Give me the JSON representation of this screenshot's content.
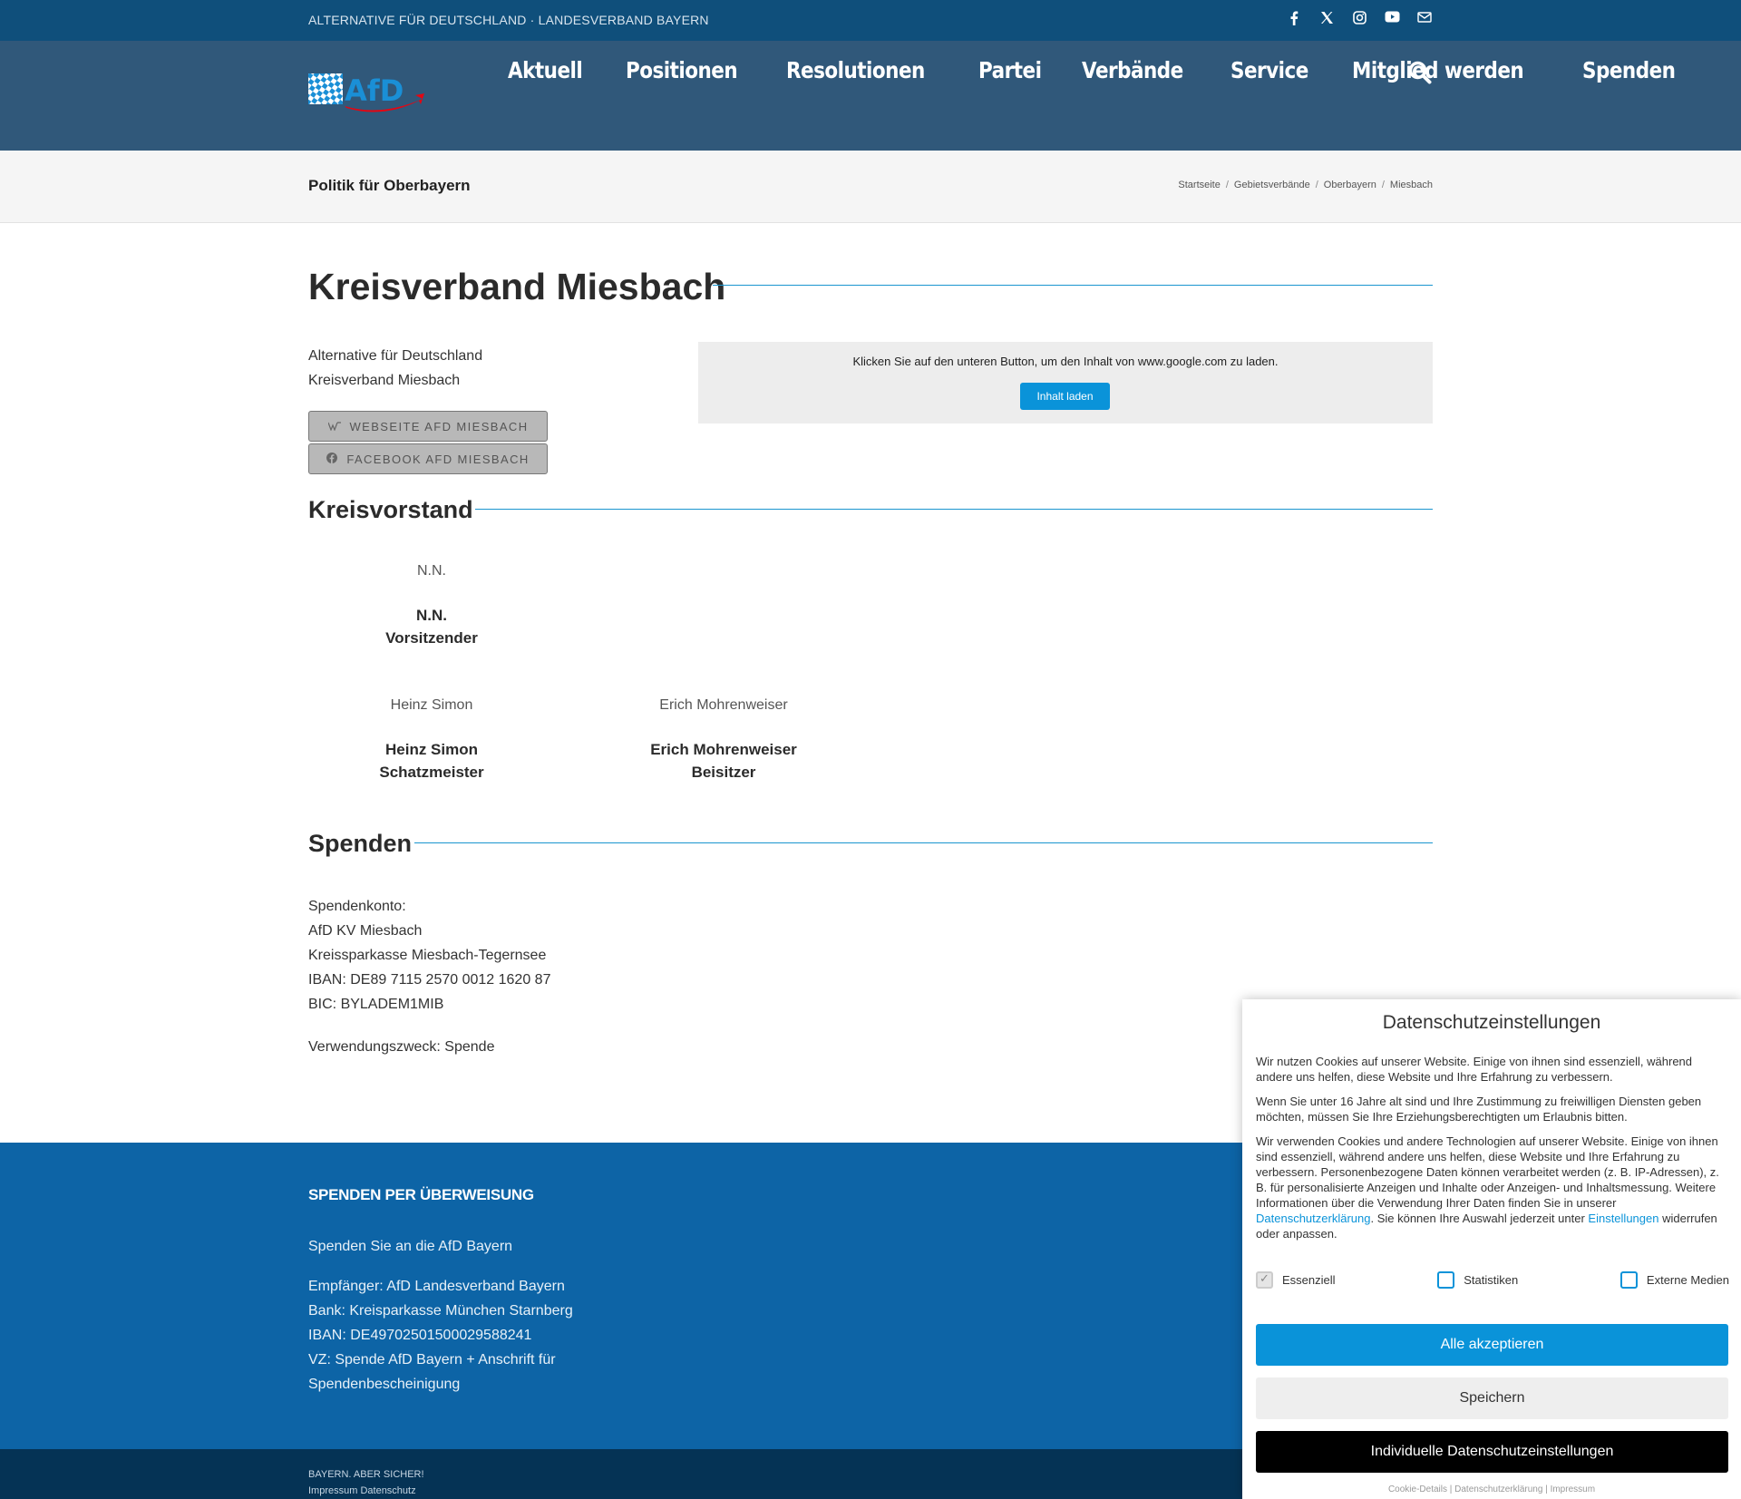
{
  "topbar": {
    "tagline": "ALTERNATIVE FÜR DEUTSCHLAND · LANDESVERBAND BAYERN",
    "social_icons": [
      "facebook-icon",
      "x-icon",
      "instagram-icon",
      "youtube-icon",
      "mail-icon"
    ]
  },
  "header": {
    "logo_text": "AfD",
    "nav": [
      "Aktuell",
      "Positionen",
      "Resolutionen",
      "Partei",
      "Verbände",
      "Service",
      "Mitglied werden",
      "Spenden"
    ]
  },
  "breadcrumb_bar": {
    "title": "Politik für Oberbayern",
    "crumbs": [
      "Startseite",
      "Gebietsverbände",
      "Oberbayern",
      "Miesbach"
    ],
    "separator": "/"
  },
  "main": {
    "heading": "Kreisverband Miesbach",
    "intro_line1": "Alternative für Deutschland",
    "intro_line2": "Kreisverband Miesbach",
    "website_button": "WEBSEITE AFD MIESBACH",
    "facebook_button": "FACEBOOK AFD MIESBACH",
    "map_consent_text": "Klicken Sie auf den unteren Button, um den Inhalt von www.google.com zu laden.",
    "map_consent_button": "Inhalt laden",
    "board_heading": "Kreisvorstand",
    "board": [
      {
        "image_alt": "N.N.",
        "name": "N.N.",
        "role": "Vorsitzender"
      },
      {
        "image_alt": "Heinz Simon",
        "name": "Heinz Simon",
        "role": "Schatzmeister"
      },
      {
        "image_alt": "Erich Mohrenweiser",
        "name": "Erich Mohrenweiser",
        "role": "Beisitzer"
      }
    ],
    "donation_heading": "Spenden",
    "donation_lines": [
      "Spendenkonto:",
      "AfD KV Miesbach",
      "Kreissparkasse Miesbach-Tegernsee",
      "IBAN: DE89 7115 2570 0012 1620 87",
      "BIC: BYLADEM1MIB"
    ],
    "donation_purpose": "Verwendungszweck: Spende"
  },
  "footer": {
    "title": "SPENDEN PER ÜBERWEISUNG",
    "intro": "Spenden Sie an die AfD Bayern",
    "lines": [
      "Empfänger: AfD Landesverband Bayern",
      "Bank: Kreisparkasse München Starnberg",
      "IBAN: DE4970250150002958824​1",
      "VZ: Spende AfD Bayern + Anschrift für",
      "Spendenbescheinigung"
    ],
    "sub_line1": "BAYERN. ABER SICHER!",
    "sub_line2": "Impressum Datenschutz"
  },
  "cookie_panel": {
    "title": "Datenschutzeinstellungen",
    "p1": "Wir nutzen Cookies auf unserer Website. Einige von ihnen sind essenziell, während andere uns helfen, diese Website und Ihre Erfahrung zu verbessern.",
    "p2": "Wenn Sie unter 16 Jahre alt sind und Ihre Zustimmung zu freiwilligen Diensten geben möchten, müssen Sie Ihre Erziehungsberechtigten um Erlaubnis bitten.",
    "p3_part1": "Wir verwenden Cookies und andere Technologien auf unserer Website. Einige von ihnen sind essenziell, während andere uns helfen, diese Website und Ihre Erfahrung zu verbessern. Personenbezogene Daten können verarbeitet werden (z. B. IP-Adressen), z. B. für personalisierte Anzeigen und Inhalte oder Anzeigen- und Inhaltsmessung. Weitere Informationen über die Verwendung Ihrer Daten finden Sie in unserer ",
    "p3_link1": "Datenschutzerklärung",
    "p3_part2": ". Sie können Ihre Auswahl jederzeit unter ",
    "p3_link2": "Einstellungen",
    "p3_part3": " widerrufen oder anpassen.",
    "cat_essential": "Essenziell",
    "cat_stats": "Statistiken",
    "cat_media": "Externe Medien",
    "accept_all": "Alle akzeptieren",
    "save": "Speichern",
    "individual": "Individuelle Datenschutzeinstellungen",
    "link_cookie": "Cookie-Details",
    "link_privacy": "Datenschutzerklärung",
    "link_imprint": "Impressum"
  }
}
